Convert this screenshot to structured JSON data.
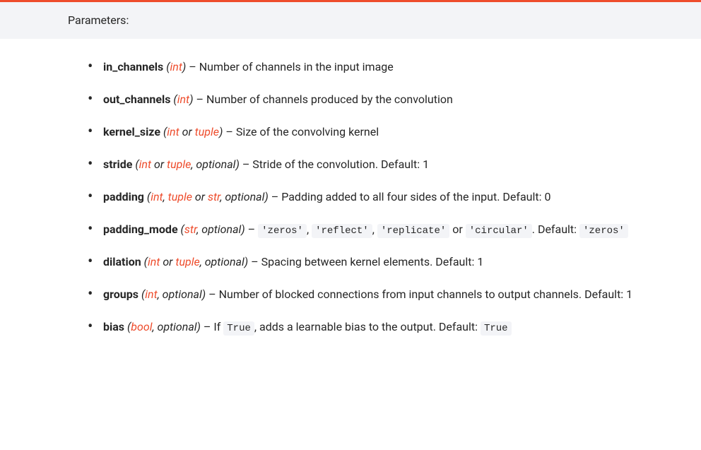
{
  "header": {
    "title": "Parameters:"
  },
  "params": [
    {
      "name": "in_channels",
      "types": [
        {
          "txt": "int",
          "link": true
        }
      ],
      "typejoin": "",
      "optional": false,
      "desc_pre": "Number of channels in the input image",
      "desc_post": "",
      "codes_mid": [],
      "codes_seq": []
    },
    {
      "name": "out_channels",
      "types": [
        {
          "txt": "int",
          "link": true
        }
      ],
      "typejoin": "",
      "optional": false,
      "desc_pre": "Number of channels produced by the convolution",
      "desc_post": "",
      "codes_mid": [],
      "codes_seq": []
    },
    {
      "name": "kernel_size",
      "types": [
        {
          "txt": "int",
          "link": true
        },
        {
          "txt": "tuple",
          "link": true
        }
      ],
      "typejoin": " or ",
      "optional": false,
      "desc_pre": "Size of the convolving kernel",
      "desc_post": "",
      "codes_mid": [],
      "codes_seq": []
    },
    {
      "name": "stride",
      "types": [
        {
          "txt": "int",
          "link": true
        },
        {
          "txt": "tuple",
          "link": true
        }
      ],
      "typejoin": " or ",
      "optional": true,
      "desc_pre": "Stride of the convolution. Default: 1",
      "desc_post": "",
      "codes_mid": [],
      "codes_seq": []
    },
    {
      "name": "padding",
      "types": [
        {
          "txt": "int",
          "link": true
        },
        {
          "txt": "tuple",
          "link": true
        },
        {
          "txt": "str",
          "link": true
        }
      ],
      "typejoin": ", or ",
      "optional": true,
      "desc_pre": "Padding added to all four sides of the input. Default: 0",
      "desc_post": "",
      "codes_mid": [],
      "codes_seq": []
    },
    {
      "name": "padding_mode",
      "types": [
        {
          "txt": "str",
          "link": true
        }
      ],
      "typejoin": "",
      "optional": true,
      "desc_pre": "",
      "desc_post": ". Default: ",
      "codes_mid": [],
      "codes_seq": [
        "'zeros'",
        "'reflect'",
        "'replicate'",
        "'circular'"
      ],
      "default_code": "'zeros'"
    },
    {
      "name": "dilation",
      "types": [
        {
          "txt": "int",
          "link": true
        },
        {
          "txt": "tuple",
          "link": true
        }
      ],
      "typejoin": " or ",
      "optional": true,
      "desc_pre": "Spacing between kernel elements. Default: 1",
      "desc_post": "",
      "codes_mid": [],
      "codes_seq": []
    },
    {
      "name": "groups",
      "types": [
        {
          "txt": "int",
          "link": true
        }
      ],
      "typejoin": "",
      "optional": true,
      "desc_pre": "Number of blocked connections from input channels to output channels. Default: 1",
      "desc_post": "",
      "codes_mid": [],
      "codes_seq": []
    },
    {
      "name": "bias",
      "types": [
        {
          "txt": "bool",
          "link": true
        }
      ],
      "typejoin": "",
      "optional": true,
      "desc_pre": "If ",
      "desc_mid_code": "True",
      "desc_mid_after": ", adds a learnable bias to the output. Default: ",
      "default_code": "True",
      "codes_seq": []
    }
  ]
}
